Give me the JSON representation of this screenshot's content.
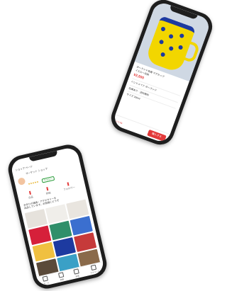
{
  "product_phone": {
    "title_lines": [
      "ポーランド食器 マグカップ",
      "イエロー花柄"
    ],
    "price": "¥2,500",
    "detail_lines": [
      "ハンドメイド ポーランド",
      "在庫あり · 送料無料",
      "サイズ 300ml"
    ],
    "footer_link": "いいね",
    "buy_label": "購入する",
    "colors": {
      "accent": "#e23a3a",
      "mug_yellow": "#f2d600",
      "mug_blue": "#1d3aa0",
      "photo_bg": "#cfd8e3"
    }
  },
  "shop_phone": {
    "header_line": "ショップ ページ",
    "shop_name": "マーケット ショップ",
    "stars": "★★★★★",
    "follow_label": "フォロー",
    "stats": [
      "出品",
      "評価",
      "フォロワー"
    ],
    "description_lines": [
      "手作りの雑貨・アクセサリーを",
      "出品しています。お気軽にどうぞ"
    ],
    "tabs": [
      "ホーム",
      "検索",
      "出品",
      "マイページ"
    ],
    "tile_colors": [
      "#e6e2dc",
      "#f0eeea",
      "#e9e5df",
      "#d6203a",
      "#2f8f6a",
      "#3b6fcf",
      "#f0c040",
      "#1d3aa0",
      "#c63a3a",
      "#5a4a3a",
      "#3aa0c6",
      "#8a6a4a"
    ]
  }
}
